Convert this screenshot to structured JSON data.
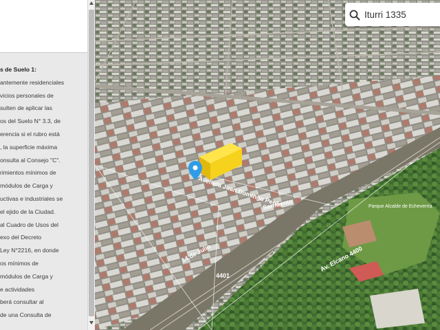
{
  "panel": {
    "heading": "s de Suelo 1:",
    "lines": [
      "antemente residenciales",
      "vicios personales de",
      "sulten de aplicar las",
      "os del Suelo N° 3.3, de",
      "erencia si el rubro está",
      ", la superficie máxima",
      "onsulta al Consejo \"C\".",
      "rimientos mínimos de",
      "módulos de Carga y",
      "uctivas e industriales se",
      "el ejido de la Ciudad.",
      "al Cuadro de Usos del",
      "exo del Decreto",
      "Ley N°2216, en donde",
      "os mínimos de",
      "módulos de Carga y",
      "e actividades",
      "berá consultar al",
      "de una Consulta de"
    ]
  },
  "search": {
    "value": "Iturri 1335",
    "icon": "search-icon"
  },
  "map": {
    "road_labels": {
      "main_avenue": "Avenida Juan Domingo Perón",
      "railway": "Sarmiento",
      "street_1": "14 de Julio",
      "street_2": "Av. Elcano 4400",
      "number": "4401"
    },
    "park_label": "Parque Alcalde de Echeverría",
    "marker_icon": "location-pin-icon",
    "highlight_color": "#f6d21c",
    "marker_color": "#2f9ce8"
  }
}
